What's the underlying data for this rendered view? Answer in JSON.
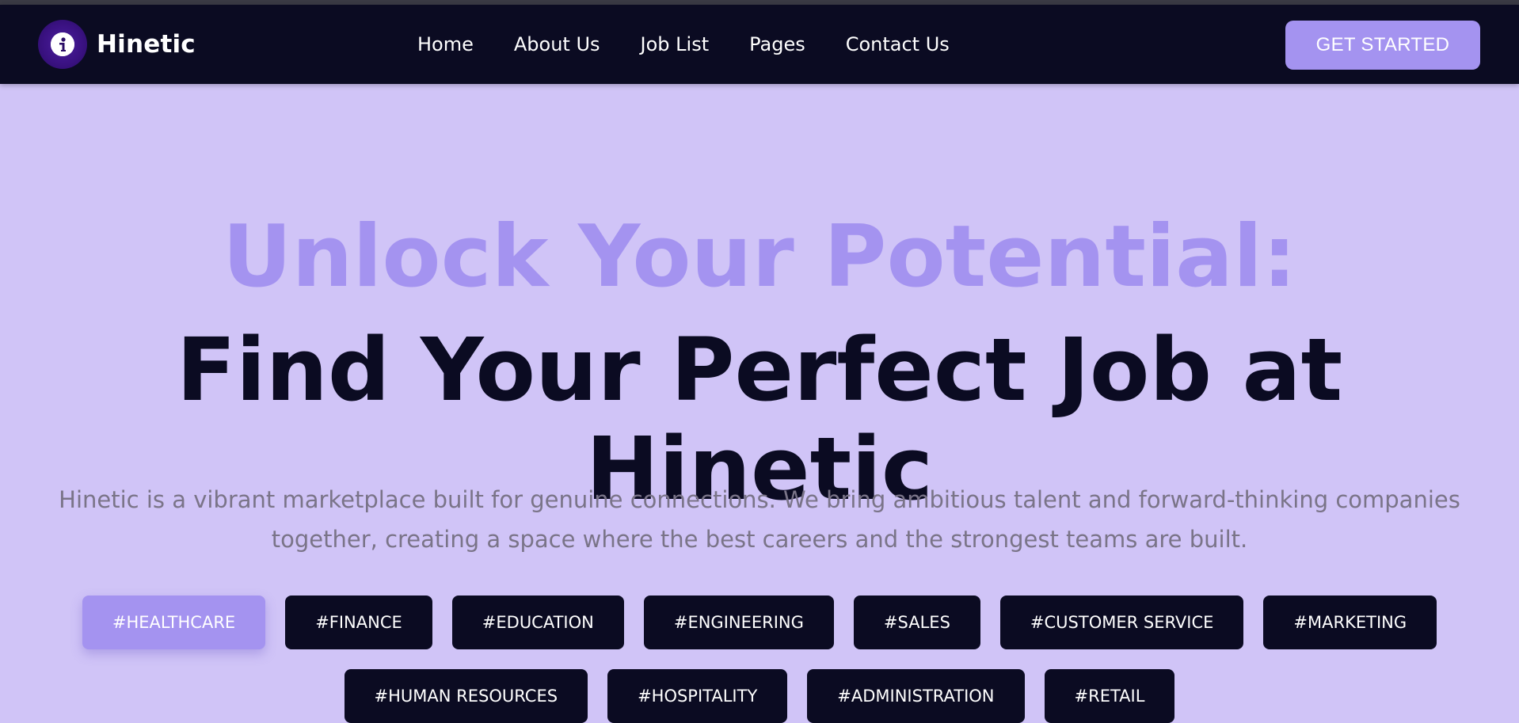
{
  "brand": {
    "name": "Hinetic",
    "logo_icon": "info-circle-icon"
  },
  "nav": {
    "items": [
      "Home",
      "About Us",
      "Job List",
      "Pages",
      "Contact Us"
    ],
    "cta_label": "GET STARTED"
  },
  "hero": {
    "title_line1": "Unlock Your Potential:",
    "title_line2": "Find Your Perfect Job at Hinetic",
    "subtitle": "Hinetic is a vibrant marketplace built for genuine connections. We bring ambitious talent and forward-thinking companies together, creating a space where the best careers and the strongest teams are built."
  },
  "tags": {
    "row1": [
      "#HEALTHCARE",
      "#FINANCE",
      "#EDUCATION",
      "#ENGINEERING",
      "#SALES",
      "#CUSTOMER SERVICE",
      "#MARKETING"
    ],
    "row2": [
      "#HUMAN RESOURCES",
      "#HOSPITALITY",
      "#ADMINISTRATION",
      "#RETAIL"
    ],
    "active": "#HEALTHCARE"
  },
  "colors": {
    "navbar_bg": "#0b0b22",
    "page_bg": "#d0c4f7",
    "accent": "#a493f0",
    "dark_text": "#0b0b22",
    "muted_text": "#7a7488"
  }
}
